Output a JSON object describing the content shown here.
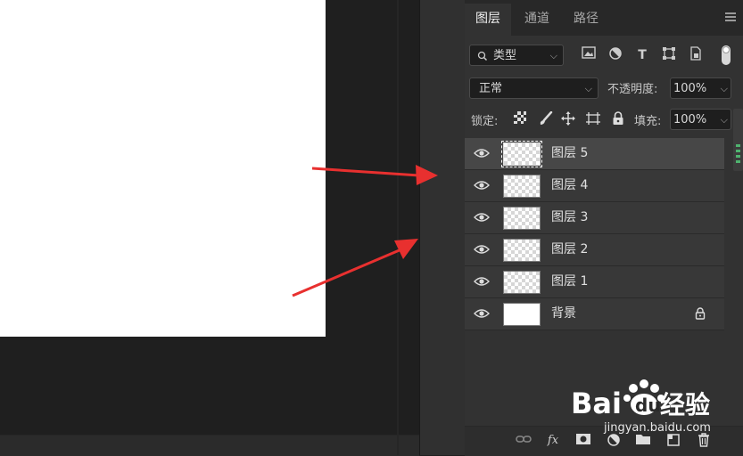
{
  "tabs": [
    {
      "label": "图层",
      "active": true
    },
    {
      "label": "通道",
      "active": false
    },
    {
      "label": "路径",
      "active": false
    }
  ],
  "filter": {
    "kind_value": "类型",
    "icons": [
      "image-filter-icon",
      "adjustment-filter-icon",
      "type-filter-icon",
      "shape-filter-icon",
      "smart-object-filter-icon"
    ]
  },
  "blend": {
    "mode_value": "正常",
    "opacity_label": "不透明度:",
    "opacity_value": "100%"
  },
  "lock": {
    "label": "锁定:",
    "icons": [
      "lock-transparent-icon",
      "lock-image-icon",
      "lock-position-icon",
      "lock-artboard-icon",
      "lock-all-icon"
    ],
    "fill_label": "填充:",
    "fill_value": "100%"
  },
  "layers": [
    {
      "name": "图层 5",
      "selected": true,
      "thumb": "transparent"
    },
    {
      "name": "图层 4",
      "selected": false,
      "thumb": "transparent"
    },
    {
      "name": "图层 3",
      "selected": false,
      "thumb": "transparent"
    },
    {
      "name": "图层 2",
      "selected": false,
      "thumb": "transparent"
    },
    {
      "name": "图层 1",
      "selected": false,
      "thumb": "transparent"
    },
    {
      "name": "背景",
      "selected": false,
      "thumb": "white",
      "locked": true
    }
  ],
  "bottom_icons": [
    "link-layers-icon",
    "fx-icon",
    "mask-icon",
    "adjustment-layer-icon",
    "group-folder-icon",
    "new-layer-icon",
    "trash-icon"
  ],
  "fx_label": "fx",
  "watermark": {
    "brand": "Bai",
    "brand2": "du",
    "cn": "经验",
    "url": "jingyan.baidu.com"
  },
  "colors": {
    "arrow": "#e8302f",
    "panel": "#323232",
    "selected_row": "#474747"
  }
}
